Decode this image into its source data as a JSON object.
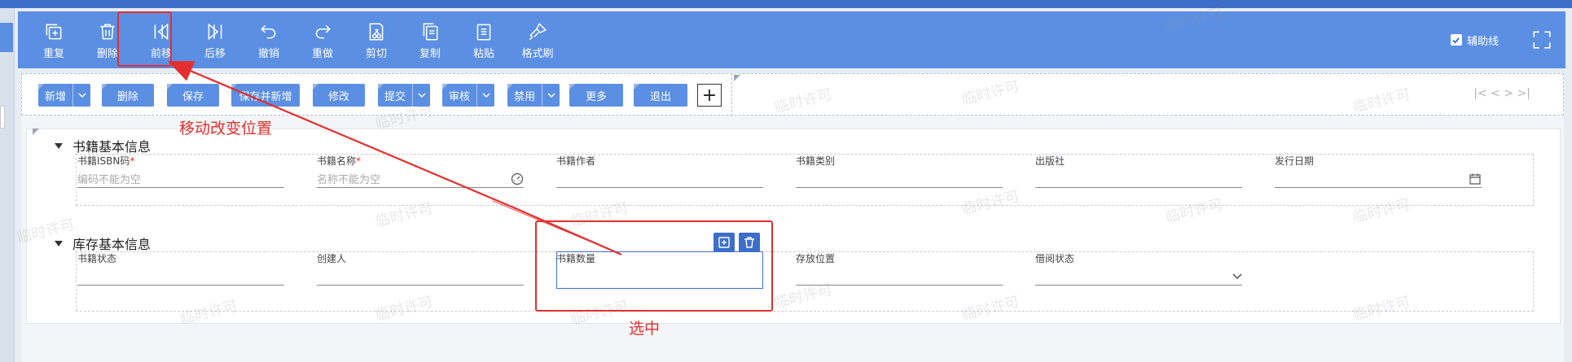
{
  "toolbar": {
    "buttons": [
      {
        "label": "重复",
        "icon": "duplicate-icon"
      },
      {
        "label": "删除",
        "icon": "trash-icon"
      },
      {
        "label": "前移",
        "icon": "move-forward-icon"
      },
      {
        "label": "后移",
        "icon": "move-backward-icon"
      },
      {
        "label": "撤销",
        "icon": "undo-icon"
      },
      {
        "label": "重做",
        "icon": "redo-icon"
      },
      {
        "label": "剪切",
        "icon": "cut-icon"
      },
      {
        "label": "复制",
        "icon": "copy-icon"
      },
      {
        "label": "粘贴",
        "icon": "paste-icon"
      },
      {
        "label": "格式刷",
        "icon": "format-brush-icon"
      }
    ],
    "guideline_label": "辅助线",
    "guideline_checked": true,
    "fullscreen_icon": "fullscreen-icon"
  },
  "action_bar": {
    "buttons": [
      {
        "label": "新增",
        "has_dropdown": true
      },
      {
        "label": "删除",
        "has_dropdown": false
      },
      {
        "label": "保存",
        "has_dropdown": false
      },
      {
        "label": "保存并新增",
        "has_dropdown": false
      },
      {
        "label": "修改",
        "has_dropdown": false
      },
      {
        "label": "提交",
        "has_dropdown": true
      },
      {
        "label": "审核",
        "has_dropdown": true
      },
      {
        "label": "禁用",
        "has_dropdown": true
      },
      {
        "label": "更多",
        "has_dropdown": false
      },
      {
        "label": "退出",
        "has_dropdown": false
      }
    ],
    "add_symbol": "+",
    "nav_arrows": "|< < > >|"
  },
  "sections": [
    {
      "title": "书籍基本信息",
      "fields": [
        {
          "label": "书籍ISBN码",
          "required": true,
          "placeholder": "编码不能为空"
        },
        {
          "label": "书籍名称",
          "required": true,
          "placeholder": "名称不能为空",
          "icon": "speedometer-icon"
        },
        {
          "label": "书籍作者",
          "required": false,
          "placeholder": ""
        },
        {
          "label": "书籍类别",
          "required": false,
          "placeholder": ""
        },
        {
          "label": "出版社",
          "required": false,
          "placeholder": ""
        },
        {
          "label": "发行日期",
          "required": false,
          "placeholder": "",
          "icon": "calendar-icon"
        }
      ]
    },
    {
      "title": "库存基本信息",
      "fields": [
        {
          "label": "书籍状态",
          "required": false,
          "placeholder": ""
        },
        {
          "label": "创建人",
          "required": false,
          "placeholder": ""
        },
        {
          "label": "书籍数量",
          "required": false,
          "placeholder": "",
          "selected": true
        },
        {
          "label": "存放位置",
          "required": false,
          "placeholder": ""
        },
        {
          "label": "借阅状态",
          "required": false,
          "placeholder": "",
          "icon": "chevron-down-icon"
        }
      ]
    }
  ],
  "annotations": {
    "move_note": "移动改变位置",
    "selected_note": "选中",
    "color": "#e52e2e"
  },
  "watermark": "临时许可",
  "colors": {
    "toolbar_bg": "#5b8fe3",
    "accent": "#3d6fc9",
    "annotation_red": "#e52e2e"
  }
}
